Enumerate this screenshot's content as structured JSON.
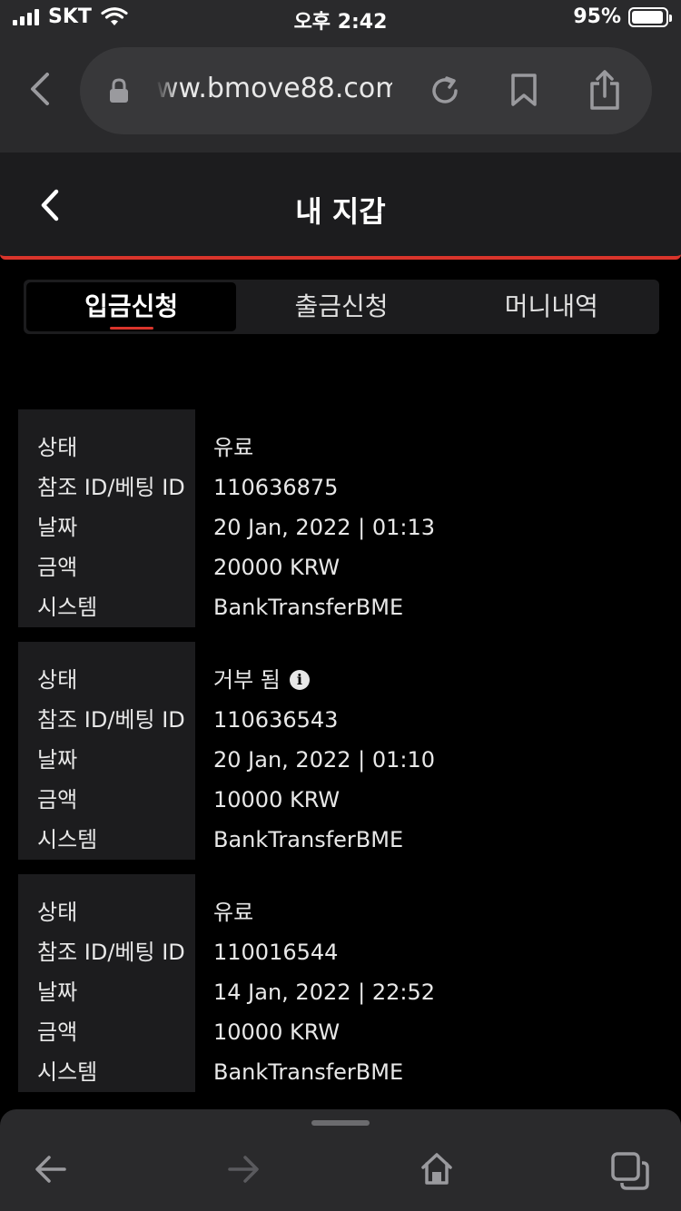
{
  "status_bar": {
    "carrier": "SKT",
    "time": "오후 2:42",
    "battery": "95%",
    "battery_level": 0.95
  },
  "browser": {
    "url": "ww.bmove88.com"
  },
  "header": {
    "title": "내 지갑"
  },
  "tabs": [
    {
      "label": "입금신청",
      "active": true
    },
    {
      "label": "출금신청",
      "active": false
    },
    {
      "label": "머니내역",
      "active": false
    }
  ],
  "labels": {
    "status": "상태",
    "ref_id": "참조 ID/베팅 ID",
    "date": "날짜",
    "amount": "금액",
    "system": "시스템"
  },
  "records": [
    {
      "status": "유료",
      "ref_id": "110636875",
      "date": "20 Jan, 2022 | 01:13",
      "amount": "20000 KRW",
      "system": "BankTransferBME",
      "info_icon": false
    },
    {
      "status": "거부 됨",
      "ref_id": "110636543",
      "date": "20 Jan, 2022 | 01:10",
      "amount": "10000 KRW",
      "system": "BankTransferBME",
      "info_icon": true
    },
    {
      "status": "유료",
      "ref_id": "110016544",
      "date": "14 Jan, 2022 | 22:52",
      "amount": "10000 KRW",
      "system": "BankTransferBME",
      "info_icon": false
    }
  ],
  "colors": {
    "accent": "#d9342b",
    "panel": "#1c1c1e",
    "chrome": "#2a2a2c"
  }
}
